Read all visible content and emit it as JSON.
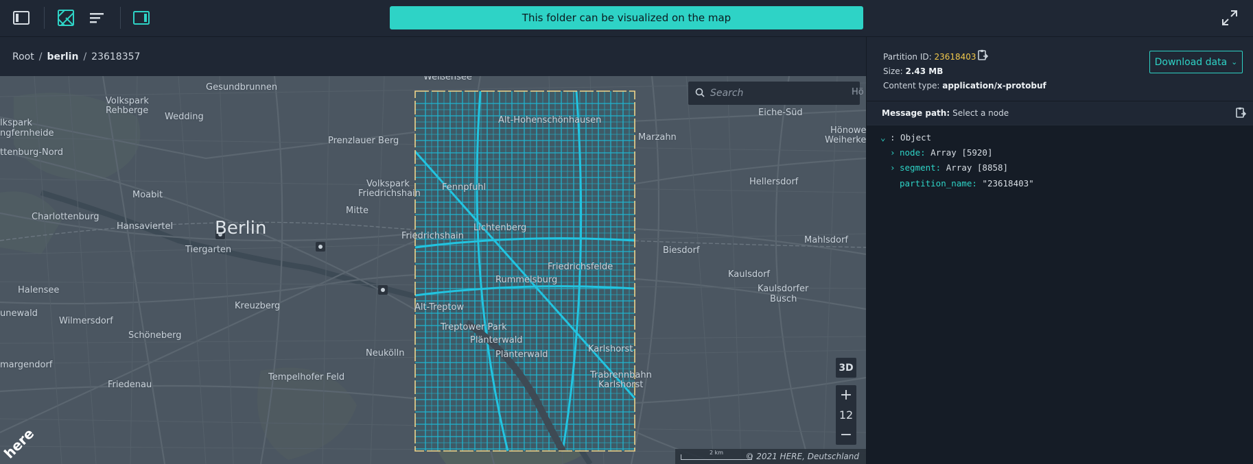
{
  "banner": {
    "text": "This folder can be visualized on the map"
  },
  "breadcrumb": {
    "root": "Root",
    "catalog": "berlin",
    "partition": "23618357"
  },
  "map": {
    "search_placeholder": "Search",
    "btn_3d": "3D",
    "zoom_level": "12",
    "zoom_in": "+",
    "zoom_out": "−",
    "scale": "2 km",
    "copyright": "© 2021 HERE, Deutschland",
    "logo": "here",
    "labels": {
      "weissensee": "Weißensee",
      "gesundbrunnen": "Gesundbrunnen",
      "volkspark_rehberge_1": "Volkspark",
      "volkspark_rehberge_2": "Rehberge",
      "wedding": "Wedding",
      "jungfernheide_1": "lkspark",
      "jungfernheide_2": "ngfernheide",
      "charlottenburg_nord": "ttenburg-Nord",
      "prenzlauer_berg": "Prenzlauer Berg",
      "alt_hohenschoenhausen": "Alt-Hohenschönhausen",
      "marzahn": "Marzahn",
      "eiche_sued": "Eiche-Süd",
      "hoenow_1": "Hönowe",
      "hoenow_2": "Weiherket",
      "moabit": "Moabit",
      "volkspark_fh_1": "Volkspark",
      "volkspark_fh_2": "Friedrichshain",
      "fennpfuhl": "Fennpfuhl",
      "hellersdorf": "Hellersdorf",
      "charlottenburg": "Charlottenburg",
      "hansaviertel": "Hansaviertel",
      "berlin": "Berlin",
      "mitte": "Mitte",
      "lichtenberg": "Lichtenberg",
      "friedrichshain": "Friedrichshain",
      "mahlsdorf": "Mahlsdorf",
      "tiergarten": "Tiergarten",
      "biesdorf": "Biesdorf",
      "friedrichsfelde": "Friedrichsfelde",
      "rummelsburg": "Rummelsburg",
      "kaulsdorf": "Kaulsdorf",
      "kaulsdorfer_busch_1": "Kaulsdorfer",
      "kaulsdorfer_busch_2": "Busch",
      "halensee": "Halensee",
      "kreuzberg": "Kreuzberg",
      "alt_treptow": "Alt-Treptow",
      "grunewald": "unewald",
      "wilmersdorf": "Wilmersdorf",
      "treptower_park": "Treptower Park",
      "schoeneberg": "Schöneberg",
      "plaenterwald_1": "Plänterwald",
      "plaenterwald_2": "Plänterwald",
      "neukoelln": "Neukölln",
      "karlshorst": "Karlshorst",
      "schmargendorf": "margendorf",
      "trabrennbahn_1": "Trabrennbahn",
      "trabrennbahn_2": "Karlshorst",
      "friedenau": "Friedenau",
      "tempelhofer_feld": "Tempelhofer Feld",
      "hoe_edge": "Hö"
    }
  },
  "panel": {
    "partition_label": "Partition ID:",
    "partition_id": "23618403",
    "size_label": "Size:",
    "size_value": "2.43 MB",
    "content_label": "Content type:",
    "content_value": "application/x-protobuf",
    "download_label": "Download data",
    "msgpath_label": "Message path:",
    "msgpath_value": "Select a node",
    "tree": {
      "root": ": Object",
      "node_key": "node:",
      "node_val": "Array [5920]",
      "segment_key": "segment:",
      "segment_val": "Array [8858]",
      "pname_key": "partition_name:",
      "pname_val": "\"23618403\""
    }
  },
  "colors": {
    "accent": "#2ed3c6",
    "partition_highlight": "#f2c94c",
    "roads": "#1fb8d4"
  }
}
